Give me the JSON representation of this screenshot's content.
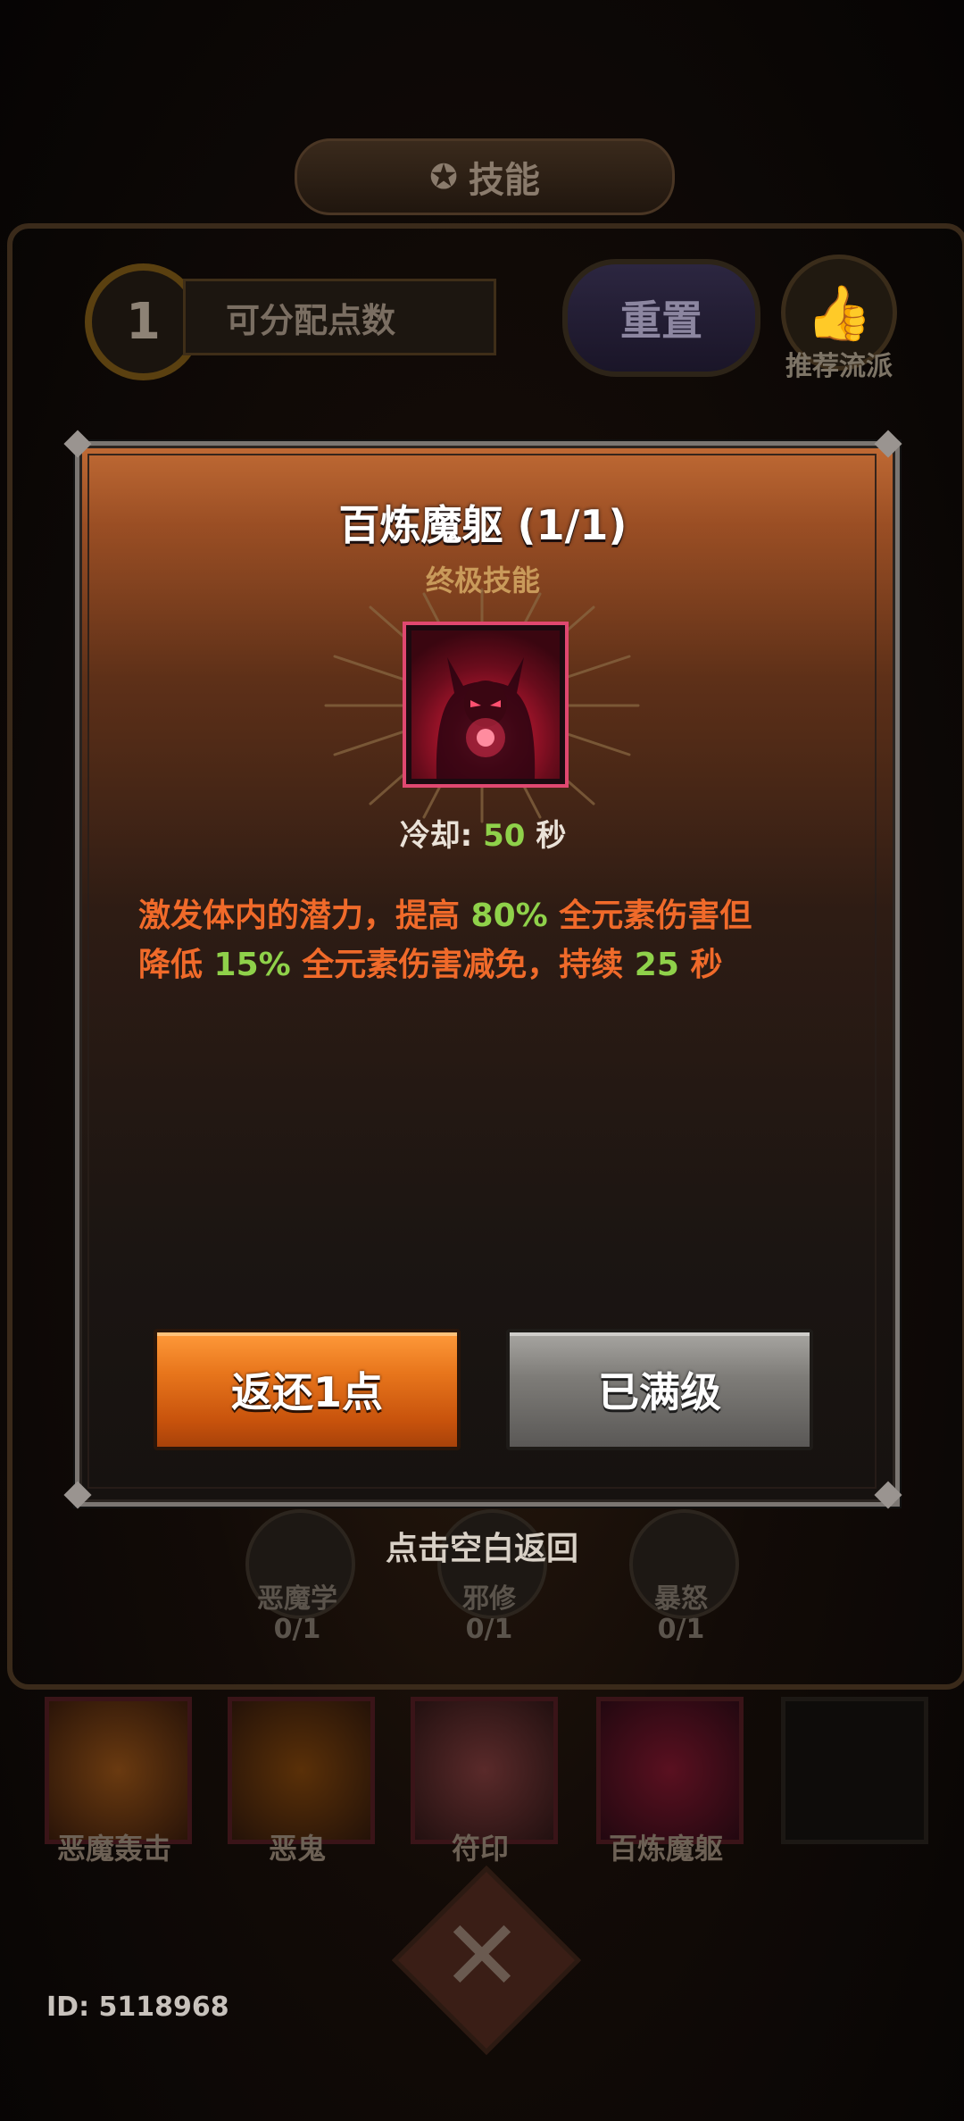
{
  "header": {
    "title": "技能"
  },
  "points": {
    "count": "1",
    "label": "可分配点数"
  },
  "actions": {
    "reset_label": "重置",
    "recommend_label": "推荐流派"
  },
  "dialog": {
    "skill_name": "百炼魔躯 (1/1)",
    "skill_type": "终极技能",
    "cooldown": {
      "label": "冷却:",
      "value": "50",
      "unit": "秒"
    },
    "description": {
      "line1_a": "激发体内的潜力，提高 ",
      "line1_val": "80%",
      "line1_b": " 全元素伤害但",
      "line2_a": "降低 ",
      "line2_val": "15%",
      "line2_b": " 全元素伤害减免，持续 ",
      "line2_val2": "25",
      "line2_c": " 秒"
    },
    "refund_button": "返还1点",
    "maxed_button": "已满级",
    "accent_color": "#8fd14a",
    "text_color": "#f06a2a"
  },
  "hint": "点击空白返回",
  "sub_skills": [
    {
      "name": "恶魔学",
      "count": "0/1"
    },
    {
      "name": "邪修",
      "count": "0/1"
    },
    {
      "name": "暴怒",
      "count": "0/1"
    }
  ],
  "equipped_skills": [
    {
      "name": "恶魔轰击"
    },
    {
      "name": "恶鬼"
    },
    {
      "name": "符印"
    },
    {
      "name": "百炼魔躯"
    }
  ],
  "footer": {
    "user_id": "ID: 5118968"
  }
}
